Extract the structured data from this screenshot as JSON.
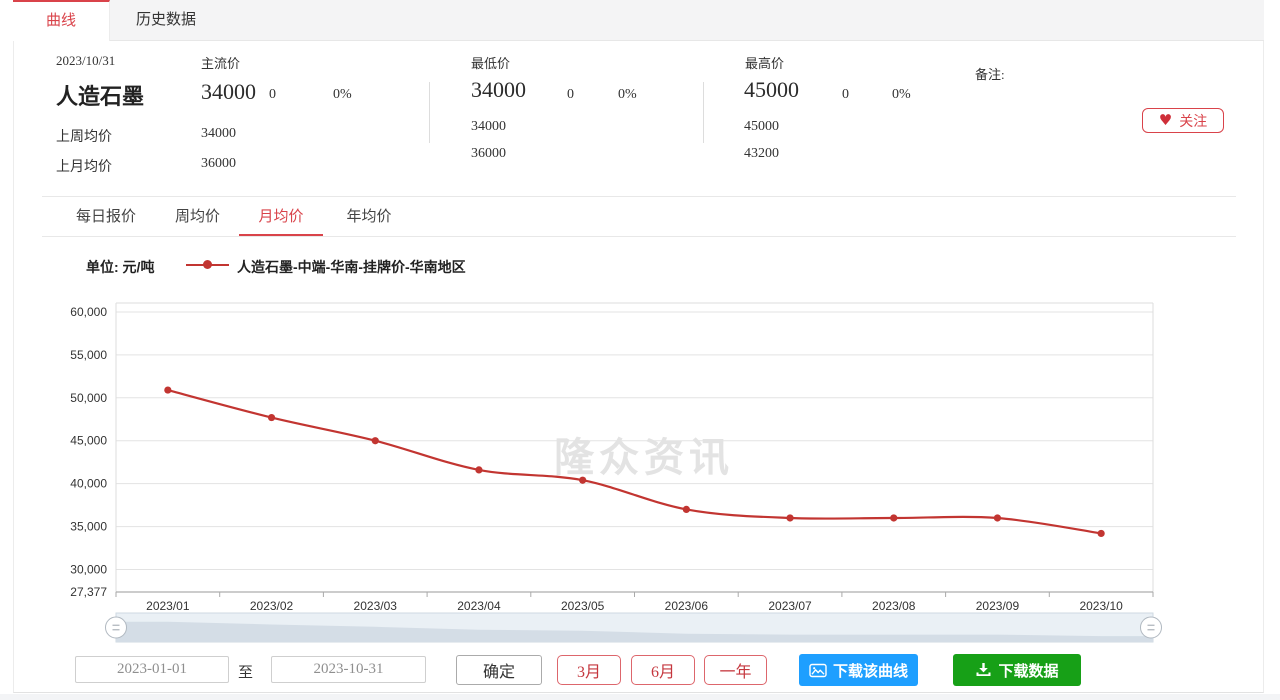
{
  "tabs": {
    "items": [
      {
        "label": "曲线",
        "active": true
      },
      {
        "label": "历史数据",
        "active": false
      }
    ]
  },
  "summary": {
    "date": "2023/10/31",
    "product_name": "人造石墨",
    "last_week_label": "上周均价",
    "last_month_label": "上月均价",
    "columns": [
      {
        "label": "主流价",
        "price": "34000",
        "change": "0",
        "change_pct": "0%",
        "last_week": "34000",
        "last_month": "36000"
      },
      {
        "label": "最低价",
        "price": "34000",
        "change": "0",
        "change_pct": "0%",
        "last_week": "34000",
        "last_month": "36000"
      },
      {
        "label": "最高价",
        "price": "45000",
        "change": "0",
        "change_pct": "0%",
        "last_week": "45000",
        "last_month": "43200"
      }
    ],
    "remark_label": "备注:",
    "follow_label": "关注"
  },
  "subtabs": {
    "items": [
      {
        "label": "每日报价",
        "active": false
      },
      {
        "label": "周均价",
        "active": false
      },
      {
        "label": "月均价",
        "active": true
      },
      {
        "label": "年均价",
        "active": false
      }
    ]
  },
  "legend": {
    "unit_label": "单位: 元/吨",
    "series_label": "人造石墨-中端-华南-挂牌价-华南地区"
  },
  "watermark": "隆众资讯",
  "icons": {
    "follow_heart": "♥"
  },
  "chart_data": {
    "type": "line",
    "title": "",
    "categories": [
      "2023/01",
      "2023/02",
      "2023/03",
      "2023/04",
      "2023/05",
      "2023/06",
      "2023/07",
      "2023/08",
      "2023/09",
      "2023/10"
    ],
    "series": [
      {
        "name": "人造石墨-中端-华南-挂牌价-华南地区",
        "values": [
          50900,
          47700,
          45000,
          41600,
          40400,
          37000,
          36000,
          36000,
          36000,
          34200
        ],
        "color": "#c23531"
      }
    ],
    "xlabel": "",
    "ylabel": "元/吨",
    "yticks": [
      27377,
      30000,
      35000,
      40000,
      45000,
      50000,
      55000,
      60000
    ],
    "ytick_labels": [
      "27,377",
      "30,000",
      "35,000",
      "40,000",
      "45,000",
      "50,000",
      "55,000",
      "60,000"
    ],
    "ylim": [
      27377,
      61045
    ],
    "grid": true,
    "smooth": true,
    "legend_position": "top-left"
  },
  "controls": {
    "date_from": "2023-01-01",
    "to_label": "至",
    "date_to": "2023-10-31",
    "confirm_label": "确定",
    "range_buttons": [
      "3月",
      "6月",
      "一年"
    ],
    "download_curve_label": "下载该曲线",
    "download_data_label": "下载数据"
  },
  "colors": {
    "accent_red": "#d9434a",
    "line_red": "#c23531",
    "download_curve_blue": "#1e9fff",
    "download_data_green": "#17a017",
    "datazoom_bg": "#eaf0f5",
    "datazoom_shadow": "#d4dde6"
  }
}
